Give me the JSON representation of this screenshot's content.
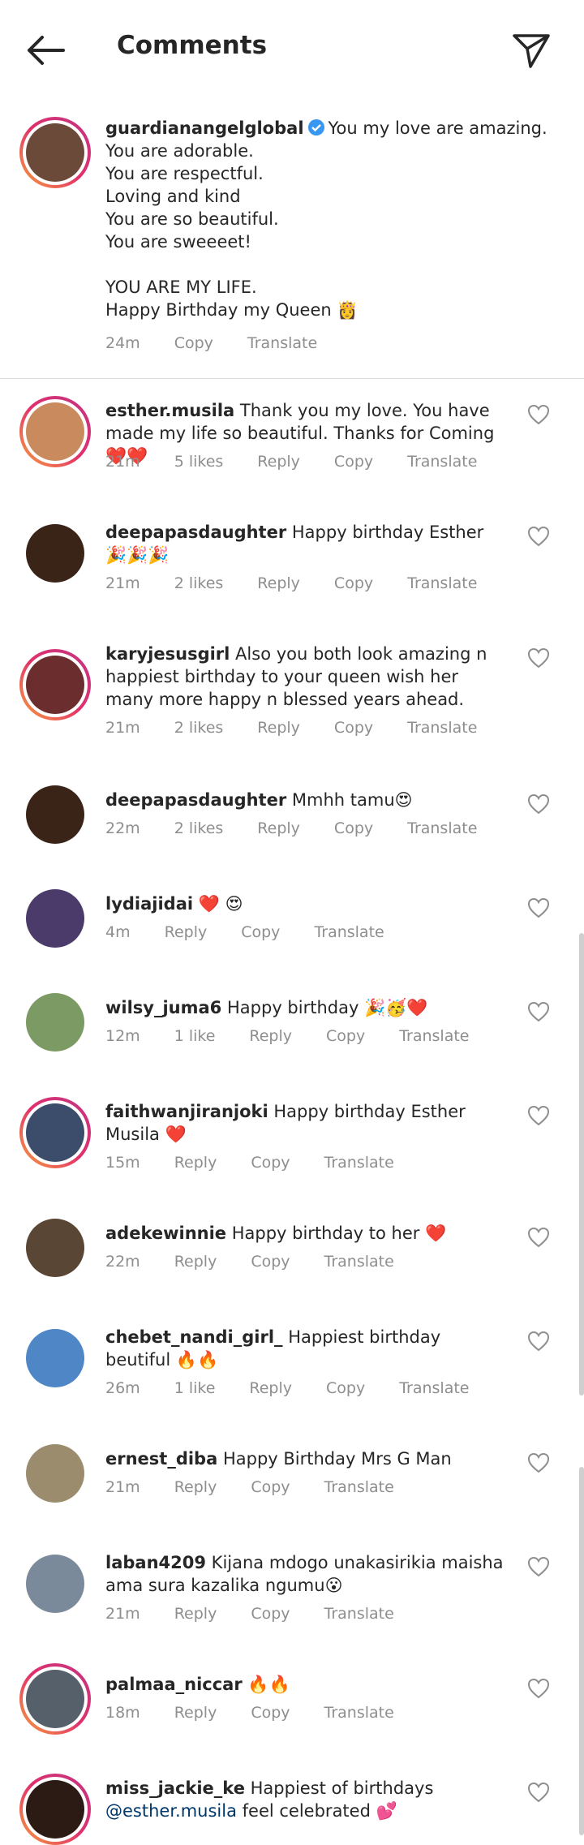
{
  "header": {
    "title": "Comments"
  },
  "caption": {
    "username": "guardianangelglobal",
    "text": "You my love are amazing.\nYou are adorable.\nYou are respectful.\nLoving and kind\nYou are so beautiful.\nYou are sweeeet!\n\n YOU ARE MY LIFE.\nHappy Birthday my Queen 👸",
    "time": "24m",
    "copy": "Copy",
    "translate": "Translate"
  },
  "comments": [
    {
      "username": "esther.musila",
      "text": "Thank you my love.  You have made my life so beautiful.  Thanks for Coming ❤️❤️",
      "time": "21m",
      "likes": "5 likes",
      "reply": "Reply",
      "copy": "Copy",
      "translate": "Translate",
      "avatar_color": "#c98b5d"
    },
    {
      "username": "deepapasdaughter",
      "text": "Happy birthday Esther 🎉🎉🎉",
      "time": "21m",
      "likes": "2 likes",
      "reply": "Reply",
      "copy": "Copy",
      "translate": "Translate",
      "avatar_color": "#3a2418"
    },
    {
      "username": "karyjesusgirl",
      "text": "Also you both look amazing n happiest birthday to your queen wish her many more happy n blessed years ahead.",
      "time": "21m",
      "likes": "2 likes",
      "reply": "Reply",
      "copy": "Copy",
      "translate": "Translate",
      "avatar_color": "#6b2d2d"
    },
    {
      "username": "deepapasdaughter",
      "text": "Mmhh tamu😍",
      "time": "22m",
      "likes": "2 likes",
      "reply": "Reply",
      "copy": "Copy",
      "translate": "Translate",
      "avatar_color": "#3a2418"
    },
    {
      "username": "lydiajidai",
      "text": "❤️ 😍",
      "time": "4m",
      "reply": "Reply",
      "copy": "Copy",
      "translate": "Translate",
      "avatar_color": "#4a3b6a"
    },
    {
      "username": "wilsy_juma6",
      "text": "Happy birthday 🎉🥳❤️",
      "time": "12m",
      "likes": "1 like",
      "reply": "Reply",
      "copy": "Copy",
      "translate": "Translate",
      "avatar_color": "#7c9a63"
    },
    {
      "username": "faithwanjiranjoki",
      "text": "Happy birthday Esther Musila ❤️",
      "time": "15m",
      "reply": "Reply",
      "copy": "Copy",
      "translate": "Translate",
      "avatar_color": "#3b4d6a"
    },
    {
      "username": "adekewinnie",
      "text": "Happy birthday to her ❤️",
      "time": "22m",
      "reply": "Reply",
      "copy": "Copy",
      "translate": "Translate",
      "avatar_color": "#5a4635"
    },
    {
      "username": "chebet_nandi_girl_",
      "text": "Happiest birthday beutiful 🔥🔥",
      "time": "26m",
      "likes": "1 like",
      "reply": "Reply",
      "copy": "Copy",
      "translate": "Translate",
      "avatar_color": "#4f86c6"
    },
    {
      "username": "ernest_diba",
      "text": "Happy Birthday Mrs G Man",
      "time": "21m",
      "reply": "Reply",
      "copy": "Copy",
      "translate": "Translate",
      "avatar_color": "#9b8c6e"
    },
    {
      "username": "laban4209",
      "text": "Kijana mdogo unakasirikia maisha ama sura kazalika ngumu😮",
      "time": "21m",
      "reply": "Reply",
      "copy": "Copy",
      "translate": "Translate",
      "avatar_color": "#7b8a9a"
    },
    {
      "username": "palmaa_niccar",
      "text": "🔥🔥",
      "time": "18m",
      "reply": "Reply",
      "copy": "Copy",
      "translate": "Translate",
      "avatar_color": "#56606b"
    },
    {
      "username": "miss_jackie_ke",
      "text": "Happiest of birthdays",
      "mention": "@esther.musila",
      "text2": "feel celebrated 💕",
      "avatar_color": "#2c1a14"
    }
  ],
  "colors": {
    "ring_start": "#f9a13b",
    "ring_end": "#c13584",
    "muted": "#8e8e8e",
    "verified": "#3897f0",
    "mention": "#00376b"
  }
}
